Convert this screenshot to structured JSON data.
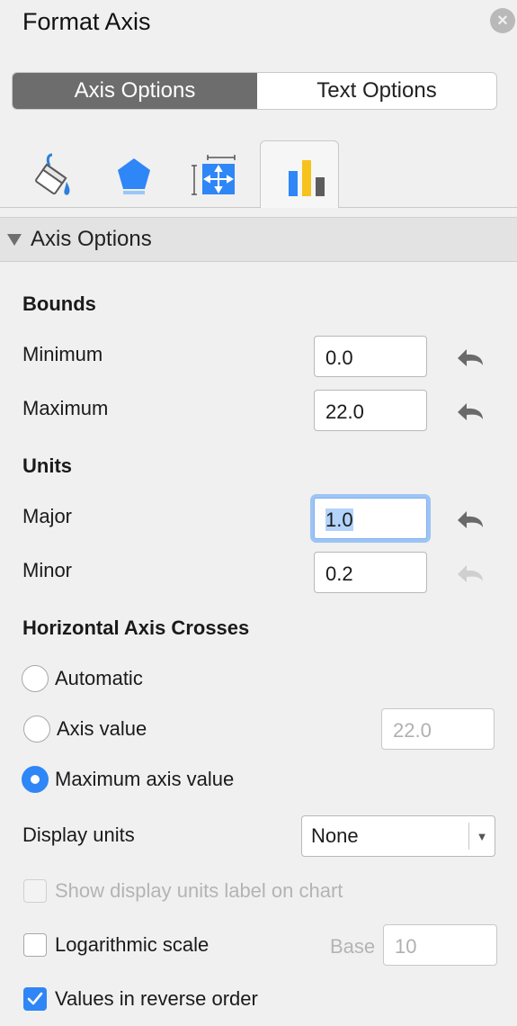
{
  "panel": {
    "title": "Format Axis"
  },
  "segments": {
    "axis_options": "Axis Options",
    "text_options": "Text Options"
  },
  "icon_tabs": [
    "paint-bucket-icon",
    "pentagon-icon",
    "size-properties-icon",
    "bar-chart-icon"
  ],
  "section": {
    "title": "Axis Options"
  },
  "bounds": {
    "heading": "Bounds",
    "minimum_label": "Minimum",
    "minimum_value": "0.0",
    "maximum_label": "Maximum",
    "maximum_value": "22.0"
  },
  "units": {
    "heading": "Units",
    "major_label": "Major",
    "major_value": "1.0",
    "minor_label": "Minor",
    "minor_value": "0.2"
  },
  "crosses": {
    "heading": "Horizontal Axis Crosses",
    "automatic": "Automatic",
    "axis_value": "Axis value",
    "axis_value_input": "22.0",
    "maximum_axis_value": "Maximum axis value",
    "selected": "maximum_axis_value"
  },
  "display_units": {
    "label": "Display units",
    "value": "None"
  },
  "show_units_label": {
    "label": "Show display units label on chart",
    "checked": false,
    "enabled": false
  },
  "log_scale": {
    "label": "Logarithmic scale",
    "checked": false,
    "base_label": "Base",
    "base_value": "10"
  },
  "reverse_order": {
    "label": "Values in reverse order",
    "checked": true
  },
  "colors": {
    "accent": "#2f86f6",
    "segment_active": "#6d6d6d",
    "focus_ring": "#9ec4f4"
  }
}
